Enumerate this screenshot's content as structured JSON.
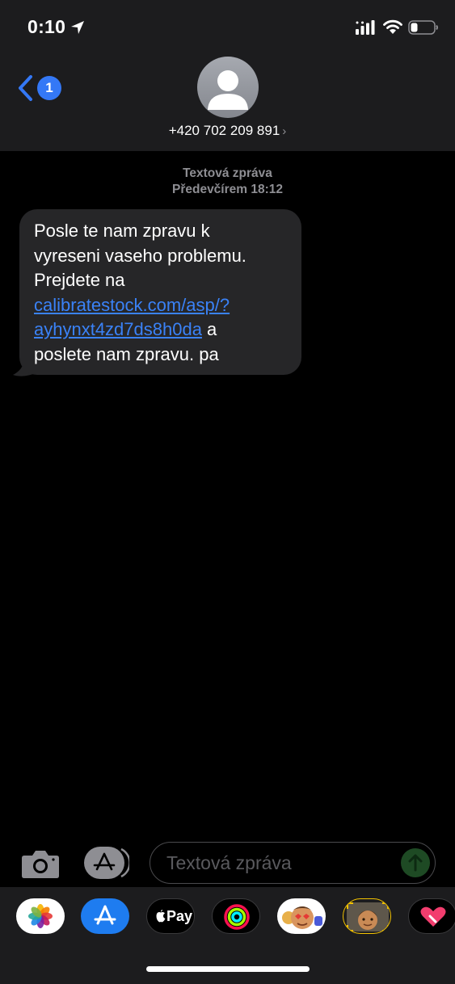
{
  "status_bar": {
    "time": "0:10",
    "icons": [
      "location-arrow-icon",
      "cellular-signal-icon",
      "wifi-icon",
      "battery-icon"
    ]
  },
  "header": {
    "back_badge_count": "1",
    "contact_name": "+420 702 209 891",
    "contact_chevron": "›"
  },
  "messages": {
    "type_label": "Textová zpráva",
    "timestamp": "Předevčírem 18:12",
    "bubble": {
      "line1": "Posle te nam zpravu  k",
      "line2": "vyreseni vaseho problemu.",
      "line3": "Prejdete na",
      "link_line1": "calibratestock.com/asp/?",
      "link_line2": "ayhynxt4zd7ds8h0da",
      "after_link": " a",
      "line6": "poslete nam zpravu. pa"
    }
  },
  "compose": {
    "placeholder": "Textová zpráva"
  },
  "app_drawer": {
    "apps": [
      "Photos",
      "App Store",
      "Apple Pay",
      "Activity",
      "Memoji Stickers",
      "Animoji",
      "Digital Touch"
    ],
    "applepay_label": "Pay"
  },
  "colors": {
    "header_bg": "#1c1c1e",
    "bubble_bg": "#262628",
    "link": "#3a82f7",
    "accent": "#3478f6",
    "meta_text": "#8e8e93"
  }
}
